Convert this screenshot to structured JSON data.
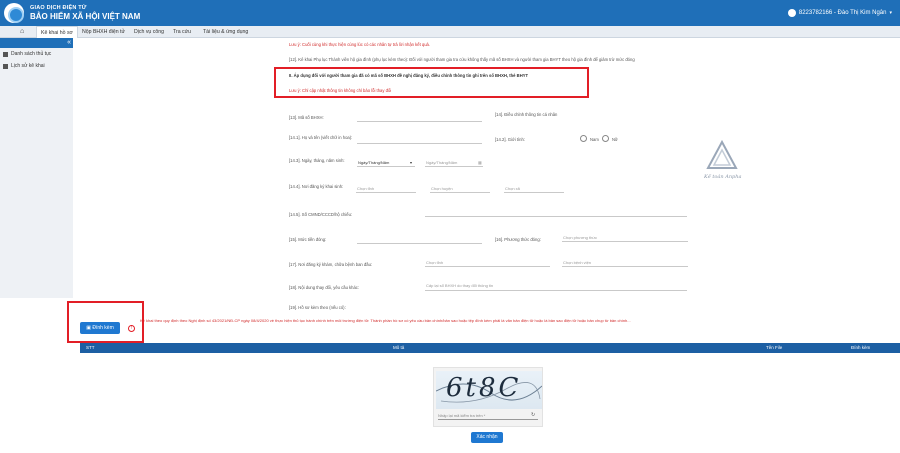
{
  "header": {
    "brand_top": "GIAO DỊCH ĐIỆN TỬ",
    "brand_main": "BẢO HIỂM XÃ HỘI VIỆT NAM",
    "user": "8223782166 - Đào Thị Kim Ngân",
    "colors": {
      "primary": "#1f6fb8",
      "alert": "#e21e26"
    }
  },
  "nav": {
    "home_icon": "home-icon",
    "items": [
      "Kê khai hồ sơ",
      "Nộp BHXH điện tử",
      "Dịch vụ công",
      "Tra cứu",
      "Tài liệu & ứng dụng"
    ]
  },
  "sidebar": {
    "toggle": "«",
    "items": [
      "Danh sách thủ tục",
      "Lịch sử kê khai"
    ]
  },
  "form": {
    "top_note": "Lưu ý: Cuối cùng khi thực hiện cùng lúc có các nhân tự trả lời nhận kết quả.",
    "item12": "[12]. Kê khai Phụ lục Thành viên hộ gia đình (phụ lục kèm theo): Đối với người tham gia tra cứu không thấy mã số BHXH và người tham gia BHYT theo hộ gia đình để giảm trừ mức đóng",
    "section_title": "II. Áp dụng đối với người tham gia đã có mã số BHXH đề nghị đăng ký, điều chỉnh thông tin ghi trên sổ BHXH, thẻ BHYT",
    "section_note": "Lưu ý: Chỉ cập nhật thông tin không chỉ bảo lỗi thay đổi",
    "f13": "[13]. Mã số BHXH:",
    "f14": "[14]. Điều chỉnh thông tin cá nhân",
    "f141": "[14.1]. Họ và tên (viết chữ in hoa):",
    "f142": "[14.2]. Giới tính:",
    "gender_male": "Nam",
    "gender_female": "Nữ",
    "f143": "[14.3]. Ngày, tháng, năm sinh:",
    "date_format": "Ngày/Tháng/Năm",
    "date_ph": "Ngày/Tháng/Năm",
    "f144": "[14.4]. Nơi đăng ký khai sinh:",
    "chon_tinh": "Chọn tỉnh",
    "chon_huyen": "Chọn huyện",
    "chon_xa": "Chọn xã",
    "f145": "[14.5]. Số CMND/CCCD/hộ chiếu:",
    "f15": "[15]. Mức tiền đóng:",
    "f16": "[16]. Phương thức đóng:",
    "phuong_thuc_ph": "Chọn phương thức",
    "f17": "[17]. Nơi đăng ký khám, chữa bệnh ban đầu:",
    "benh_vien_ph": "Chọn bệnh viện",
    "f18": "[18]. Nội dung thay đổi, yêu cầu khác:",
    "f18_ph": "Cấp lại sổ BHXH do thay đổi thông tin",
    "f19": "[19]. Hồ sơ kèm theo (nếu có):"
  },
  "bottom": {
    "attach_button": "Đính kèm",
    "legal_note": "Kê khai theo quy định theo Nghị định số 43/2021/NĐ-CP ngày 08/4/2020 về thực hiện thủ tục hành chính trên môi trường điện tử: Thành phần hồ sơ có yêu cầu bản chính/bản sao hoặc tệp đính kèm phải là văn bản điện tử hoặc là bản sao điện tử hoặc bản chụp từ bản chính..."
  },
  "table": {
    "headers": [
      "STT",
      "Mô tả",
      "Tên File",
      "Đính kèm"
    ]
  },
  "captcha": {
    "code": "6t8C",
    "placeholder": "Nhập lại mã kiểm tra trên *",
    "submit": "Xác nhận"
  }
}
